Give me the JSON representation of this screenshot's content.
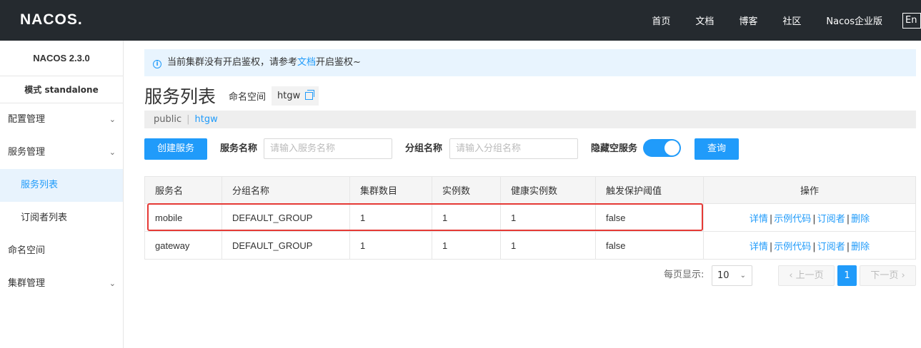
{
  "header": {
    "logo": "NACOS.",
    "nav": [
      "首页",
      "文档",
      "博客",
      "社区",
      "Nacos企业版"
    ],
    "lang": "En"
  },
  "sidebar": {
    "version": "NACOS 2.3.0",
    "mode": "模式 standalone",
    "items": [
      {
        "label": "配置管理",
        "expandable": true
      },
      {
        "label": "服务管理",
        "expandable": true
      },
      {
        "label": "服务列表",
        "sub": true,
        "active": true
      },
      {
        "label": "订阅者列表",
        "sub": true
      },
      {
        "label": "命名空间"
      },
      {
        "label": "集群管理",
        "expandable": true
      }
    ]
  },
  "notice": {
    "icon": "info-icon",
    "before": "当前集群没有开启鉴权，请参考",
    "link": "文档",
    "after": "开启鉴权~"
  },
  "page": {
    "title": "服务列表",
    "namespace_label": "命名空间",
    "namespace_value": "htgw"
  },
  "ns_bar": {
    "items": [
      "public",
      "htgw"
    ],
    "active": "htgw"
  },
  "filters": {
    "create_button": "创建服务",
    "service_name_label": "服务名称",
    "service_name_placeholder": "请输入服务名称",
    "group_name_label": "分组名称",
    "group_name_placeholder": "请输入分组名称",
    "hide_empty_label": "隐藏空服务",
    "hide_empty_on": true,
    "query_button": "查询"
  },
  "table": {
    "columns": [
      "服务名",
      "分组名称",
      "集群数目",
      "实例数",
      "健康实例数",
      "触发保护阈值",
      "操作"
    ],
    "rows": [
      {
        "name": "mobile",
        "group": "DEFAULT_GROUP",
        "clusters": "1",
        "instances": "1",
        "healthy": "1",
        "threshold": "false"
      },
      {
        "name": "gateway",
        "group": "DEFAULT_GROUP",
        "clusters": "1",
        "instances": "1",
        "healthy": "1",
        "threshold": "false"
      }
    ],
    "actions": [
      "详情",
      "示例代码",
      "订阅者",
      "删除"
    ]
  },
  "pagination": {
    "per_page_label": "每页显示:",
    "per_page": "10",
    "prev": "上一页",
    "next": "下一页",
    "current": "1"
  },
  "colors": {
    "accent": "#209bfa",
    "topbar": "#252a2f",
    "highlight": "#e53935"
  }
}
